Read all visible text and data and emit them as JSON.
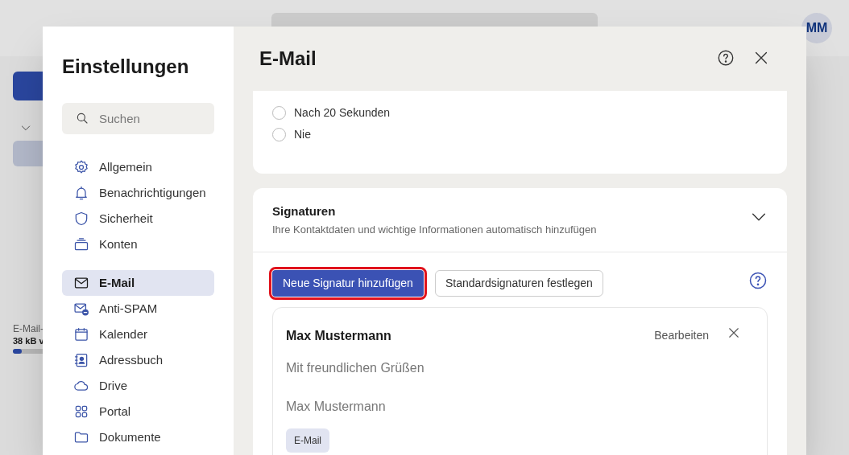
{
  "background_app": {
    "avatar": "MM",
    "storage_label": "E-Mail-",
    "storage_usage": "38 kB v",
    "storage_bar": {
      "level": 0.18
    }
  },
  "settings": {
    "title": "Einstellungen",
    "search": {
      "placeholder": "Suchen"
    },
    "nav_groups": [
      [
        {
          "label": "Allgemein",
          "selected": false
        },
        {
          "label": "Benachrichtigungen",
          "selected": false
        },
        {
          "label": "Sicherheit",
          "selected": false
        },
        {
          "label": "Konten",
          "selected": false
        }
      ],
      [
        {
          "label": "E-Mail",
          "selected": true
        },
        {
          "label": "Anti-SPAM",
          "selected": false
        },
        {
          "label": "Kalender",
          "selected": false
        },
        {
          "label": "Adressbuch",
          "selected": false
        },
        {
          "label": "Drive",
          "selected": false
        },
        {
          "label": "Portal",
          "selected": false
        },
        {
          "label": "Dokumente",
          "selected": false
        }
      ]
    ]
  },
  "panel": {
    "title": "E-Mail",
    "radio_options": [
      {
        "label": "Nach 20 Sekunden",
        "selected": false
      },
      {
        "label": "Nie",
        "selected": false
      }
    ],
    "signatures": {
      "title": "Signaturen",
      "subtitle": "Ihre Kontaktdaten und wichtige Informationen automatisch hinzufügen",
      "expanded": true,
      "primary_button": "Neue Signatur hinzufügen",
      "secondary_button": "Standardsignaturen festlegen",
      "items": [
        {
          "name": "Max Mustermann",
          "edit": "Bearbeiten",
          "lines": [
            "Mit freundlichen Grüßen",
            "Max Mustermann"
          ],
          "tag": "E-Mail"
        }
      ]
    }
  }
}
